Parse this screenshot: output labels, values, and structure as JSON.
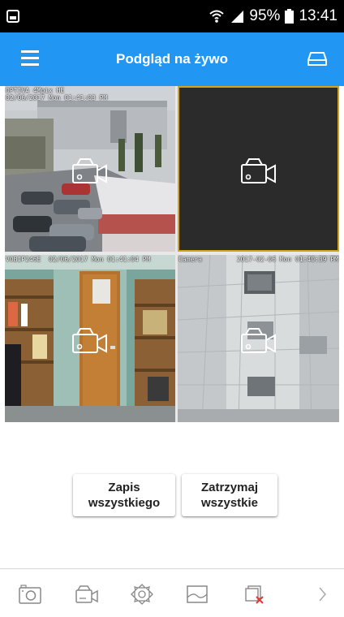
{
  "status_bar": {
    "battery": "95%",
    "time": "13:41"
  },
  "app_bar": {
    "title": "Podgląd na żywo",
    "menu_icon": "hamburger-menu-icon",
    "right_icon": "storage-drive-icon"
  },
  "cameras": [
    {
      "osd_line1": "OPTIVA 4Mpix HE",
      "osd_line2": "02/06/2017 Mon 01:41:03 PM"
    },
    {
      "osd_line1": "",
      "osd_line2": ""
    },
    {
      "osd_left": "VOBIP246E  02/06/2017 Mon 01:41:04 PM",
      "osd_right": ""
    },
    {
      "osd_left": "Camera",
      "osd_right": "2017-02-06 Mon 01:40:39 PM"
    }
  ],
  "actions": {
    "record_all_line1": "Zapis",
    "record_all_line2": "wszystkiego",
    "stop_all_line1": "Zatrzymaj",
    "stop_all_line2": "wszystkie"
  },
  "toolbar_icons": [
    "snapshot-icon",
    "record-video-icon",
    "ptz-control-icon",
    "image-settings-icon",
    "close-stream-icon",
    "next-chevron-icon"
  ],
  "colors": {
    "app_bar": "#2196f3",
    "selected_tile_border": "#d4a21e",
    "close_icon_accent": "#e53935"
  }
}
